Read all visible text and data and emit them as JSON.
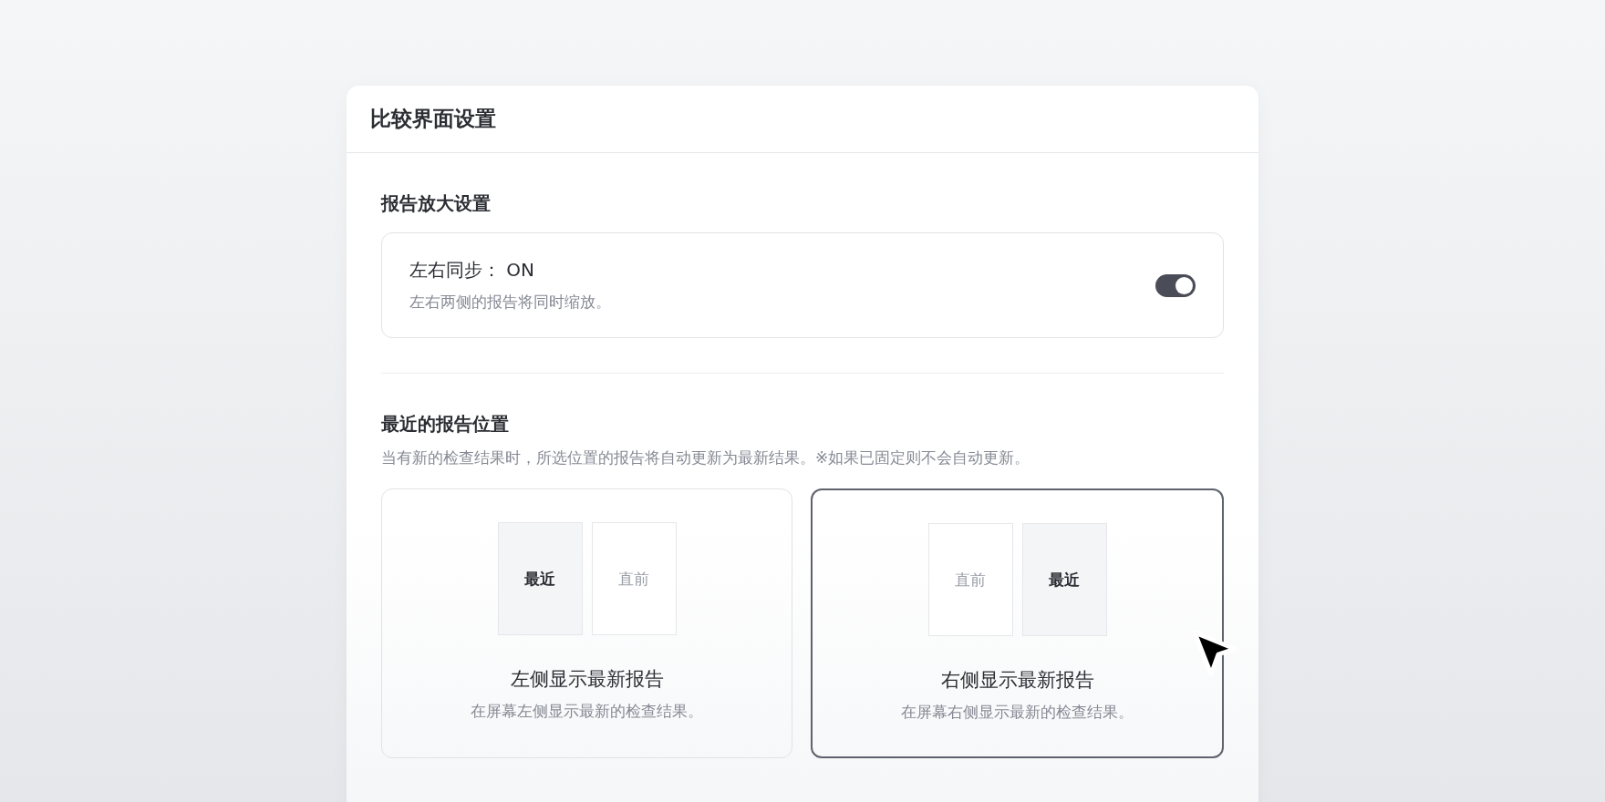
{
  "window": {
    "title": "比较界面设置"
  },
  "zoom_section": {
    "heading": "报告放大设置",
    "setting": {
      "label": "左右同步： ON",
      "description": "左右两侧的报告将同时缩放。",
      "on": true
    }
  },
  "position_section": {
    "heading": "最近的报告位置",
    "description": "当有新的检查结果时，所选位置的报告将自动更新为最新结果。※如果已固定则不会自动更新。",
    "options": [
      {
        "title": "左侧显示最新报告",
        "description": "在屏幕左侧显示最新的检查结果。",
        "selected": false,
        "panes": [
          {
            "text": "最近",
            "kind": "latest"
          },
          {
            "text": "直前",
            "kind": "previous"
          }
        ]
      },
      {
        "title": "右侧显示最新报告",
        "description": "在屏幕右侧显示最新的检查结果。",
        "selected": true,
        "panes": [
          {
            "text": "直前",
            "kind": "previous"
          },
          {
            "text": "最近",
            "kind": "latest"
          }
        ]
      }
    ]
  }
}
